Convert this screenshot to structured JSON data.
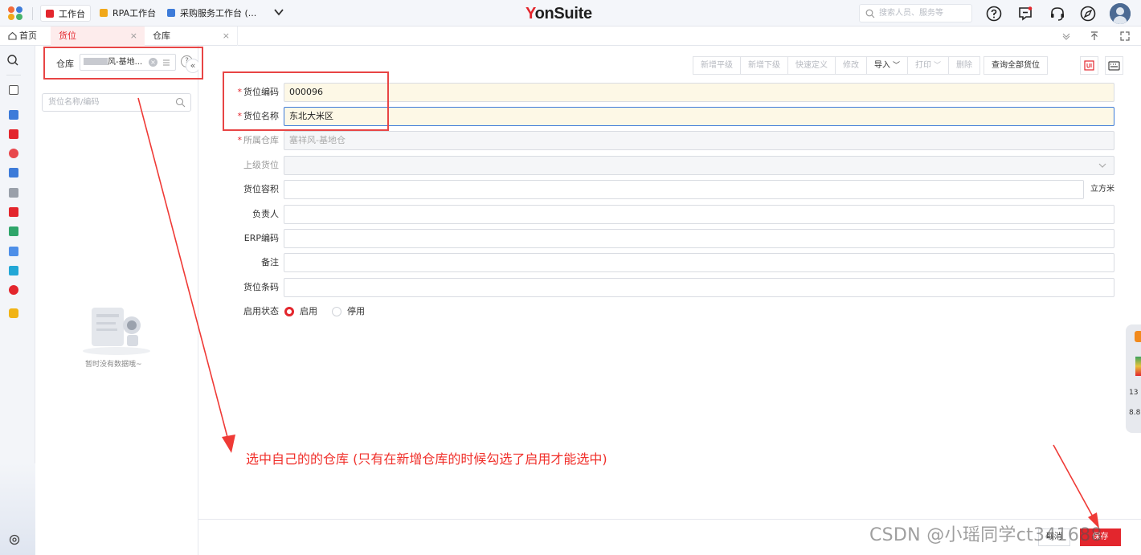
{
  "topbar": {
    "workspaces": [
      {
        "label": "工作台",
        "icon": "workbench-icon",
        "color": "#e3262d"
      },
      {
        "label": "RPA工作台",
        "icon": "rpa-icon",
        "color": "#f1a81a"
      },
      {
        "label": "采购服务工作台 (...",
        "icon": "procurement-icon",
        "color": "#3d7bd9"
      }
    ],
    "brand": {
      "first": "Y",
      "rest": "onSuite"
    },
    "search_placeholder": "搜索人员、服务等"
  },
  "tabs": {
    "home": "首页",
    "active": "货位",
    "second": "仓库",
    "close_glyph": "×"
  },
  "left_panel": {
    "warehouse_label": "仓库",
    "warehouse_value_suffix": "风-基地...",
    "search_placeholder": "货位名称/编码",
    "empty_text": "暂时没有数据哦~"
  },
  "toolbar": {
    "buttons": [
      {
        "label": "新增平级",
        "enabled": false
      },
      {
        "label": "新增下级",
        "enabled": false
      },
      {
        "label": "快速定义",
        "enabled": false
      },
      {
        "label": "修改",
        "enabled": false
      },
      {
        "label": "导入",
        "enabled": true,
        "caret": true
      },
      {
        "label": "打印",
        "enabled": false,
        "caret": true
      },
      {
        "label": "删除",
        "enabled": false
      },
      {
        "label": "查询全部货位",
        "enabled": true
      }
    ]
  },
  "form": {
    "code": {
      "label": "货位编码",
      "value": "000096"
    },
    "name": {
      "label": "货位名称",
      "value": "东北大米区"
    },
    "warehouse": {
      "label": "所属仓库",
      "value": "塞祥风-基地仓"
    },
    "parent": {
      "label": "上级货位",
      "value": ""
    },
    "volume": {
      "label": "货位容积",
      "value": "",
      "unit": "立方米"
    },
    "owner": {
      "label": "负责人",
      "value": ""
    },
    "erp_code": {
      "label": "ERP编码",
      "value": ""
    },
    "remark": {
      "label": "备注",
      "value": ""
    },
    "barcode": {
      "label": "货位条码",
      "value": ""
    },
    "status": {
      "label": "启用状态",
      "options": [
        "启用",
        "停用"
      ],
      "selected": "启用"
    }
  },
  "footer": {
    "cancel": "取消",
    "save": "保存"
  },
  "float_widget": {
    "top": "1",
    "value1": "13",
    "value2": "8.8"
  },
  "annotation": {
    "text": "选中自己的的仓库 (只有在新增仓库的时候勾选了启用才能选中)",
    "color": "#f0302b"
  },
  "watermark": "CSDN @小瑶同学ct341688"
}
